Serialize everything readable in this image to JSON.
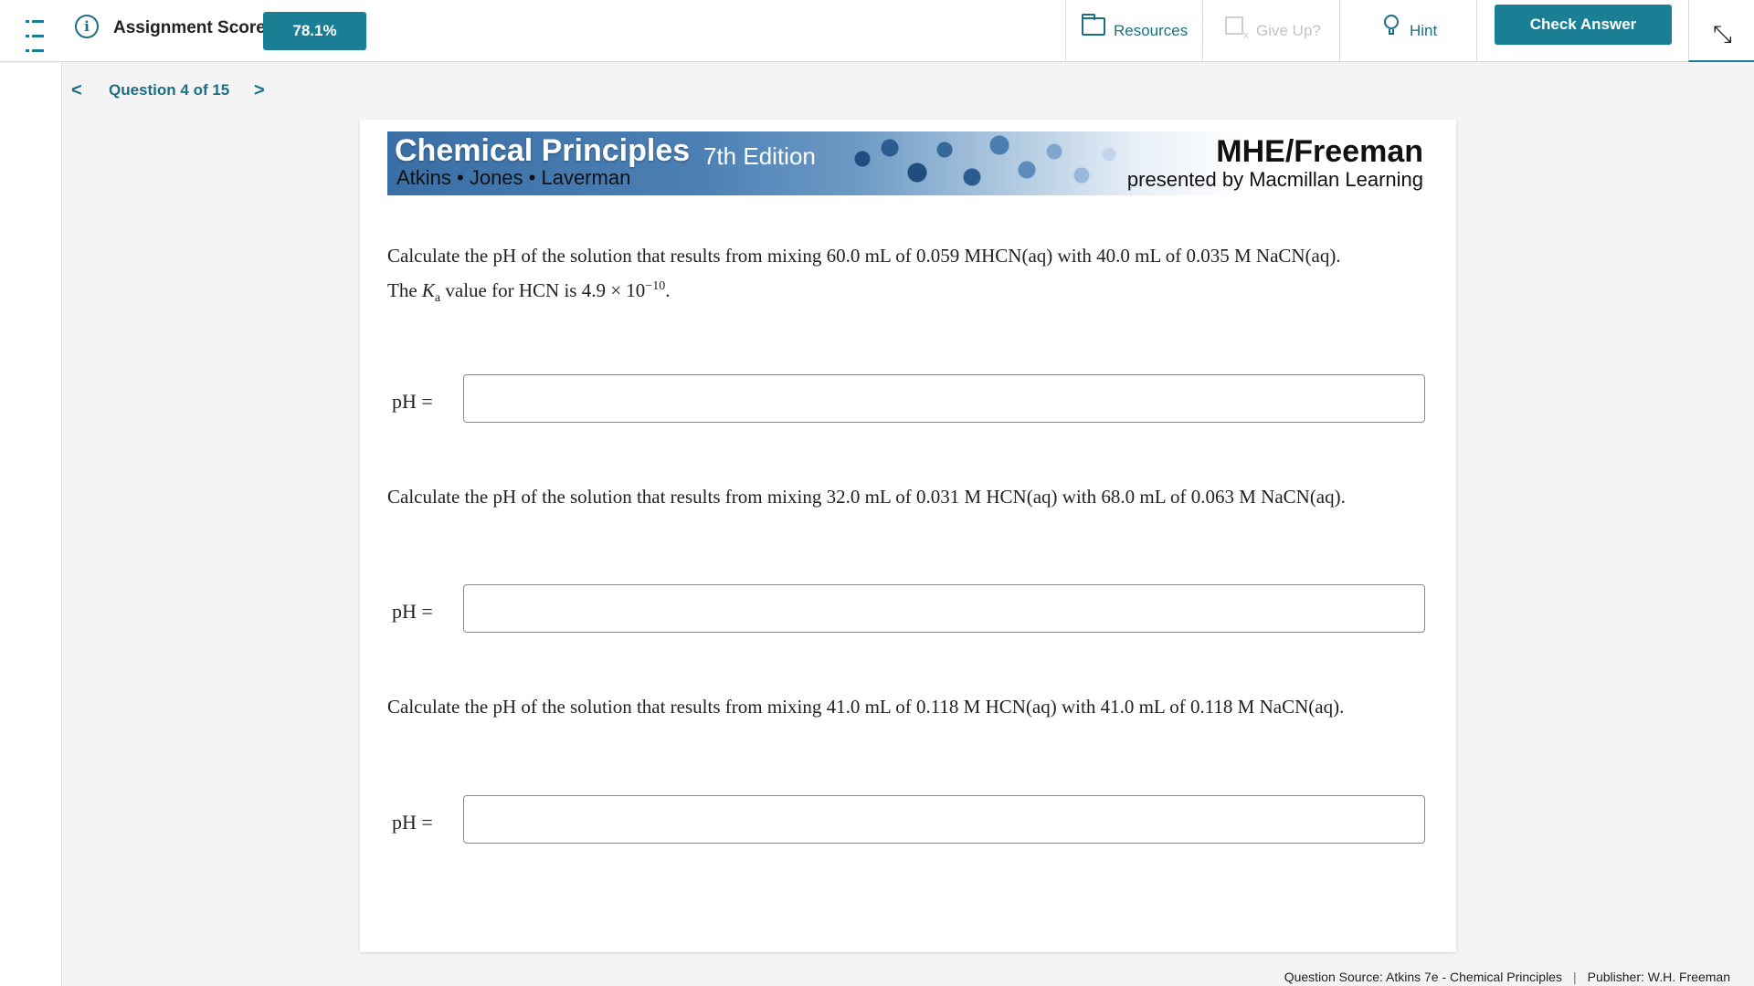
{
  "header": {
    "score_label": "Assignment Score:",
    "score_value": "78.1%",
    "tools": [
      {
        "label": "Resources",
        "icon": "folder-icon",
        "enabled": true
      },
      {
        "label": "Give Up?",
        "icon": "give-up-icon",
        "enabled": false
      },
      {
        "label": "Hint",
        "icon": "lightbulb-icon",
        "enabled": true
      }
    ],
    "check_answer_label": "Check Answer",
    "accent_color": "#1a7f94"
  },
  "nav": {
    "prev_symbol": "<",
    "question_label": "Question 4 of 15",
    "next_symbol": ">"
  },
  "banner": {
    "title": "Chemical Principles",
    "edition": "7th Edition",
    "authors": "Atkins • Jones • Laverman",
    "publisher": "MHE/Freeman",
    "presented_by": "presented by Macmillan Learning"
  },
  "questions": [
    {
      "line1": "Calculate the pH of the solution that results from mixing 60.0 mL of 0.059 MHCN(aq) with 40.0 mL of 0.035 M NaCN(aq).",
      "line2_pre": "The",
      "ka_symbol": "K",
      "ka_sub": "a",
      "line2_mid": "value for HCN is 4.9 × 10",
      "exponent": "−10",
      "line2_end": ".",
      "answer_label": "pH =",
      "answer_value": ""
    },
    {
      "line1": "Calculate the pH of the solution that results from mixing 32.0 mL of 0.031 M HCN(aq) with 68.0 mL of 0.063 M NaCN(aq).",
      "answer_label": "pH =",
      "answer_value": ""
    },
    {
      "line1": "Calculate the pH of the solution that results from mixing 41.0 mL of 0.118 M HCN(aq) with 41.0 mL of 0.118 M NaCN(aq).",
      "answer_label": "pH =",
      "answer_value": ""
    }
  ],
  "footer": {
    "source": "Question Source: Atkins 7e - Chemical Principles",
    "separator": "|",
    "publisher": "Publisher: W.H. Freeman"
  }
}
